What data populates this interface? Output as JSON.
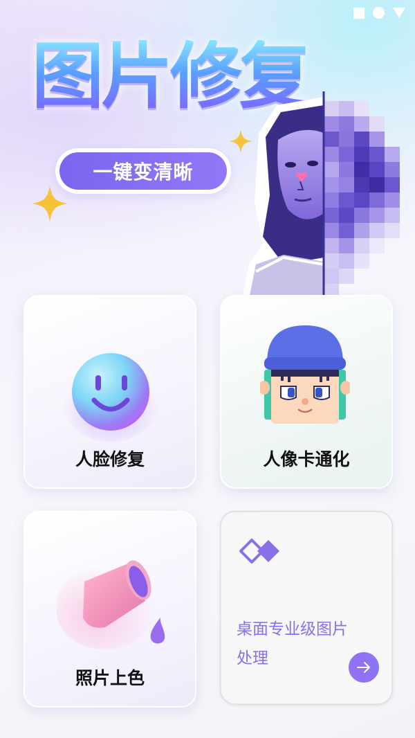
{
  "status_bar": {
    "icons": [
      "square-icon",
      "circle-icon",
      "triangle-icon"
    ]
  },
  "hero": {
    "title": "图片修复",
    "subtitle": "一键变清晰"
  },
  "features": [
    {
      "label": "人脸修复",
      "icon": "smiley-face-icon"
    },
    {
      "label": "人像卡通化",
      "icon": "cartoon-avatar-icon"
    },
    {
      "label": "照片上色",
      "icon": "paint-bucket-icon"
    }
  ],
  "desktop_card": {
    "line1": "桌面专业级图片",
    "line2": "处理",
    "icon": "diamond-logo-icon",
    "action_icon": "arrow-right-icon"
  },
  "colors": {
    "accent": "#8f73f4",
    "pill": "#7b64f0",
    "title_gradient": [
      "#86e4ff",
      "#5aa0ff",
      "#7c67ff"
    ]
  }
}
